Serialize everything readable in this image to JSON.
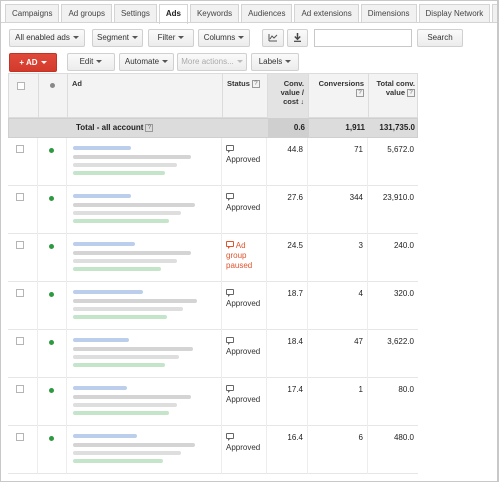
{
  "tabs": [
    {
      "label": "Campaigns",
      "active": false
    },
    {
      "label": "Ad groups",
      "active": false
    },
    {
      "label": "Settings",
      "active": false
    },
    {
      "label": "Ads",
      "active": true
    },
    {
      "label": "Keywords",
      "active": false
    },
    {
      "label": "Audiences",
      "active": false
    },
    {
      "label": "Ad extensions",
      "active": false
    },
    {
      "label": "Dimensions",
      "active": false
    },
    {
      "label": "Display Network",
      "active": false
    }
  ],
  "toolbar": {
    "filter_select": "All enabled ads",
    "segment": "Segment",
    "filter": "Filter",
    "columns": "Columns",
    "search_placeholder": "",
    "search_button": "Search",
    "add_ad": "+ AD",
    "edit": "Edit",
    "automate": "Automate",
    "more_actions": "More actions...",
    "labels": "Labels"
  },
  "table": {
    "headers": {
      "ad": "Ad",
      "status": "Status",
      "conv_value_cost": "Conv. value / cost",
      "conversions": "Conversions",
      "total_conv_value": "Total conv. value"
    },
    "total": {
      "label": "Total - all account",
      "conv_value_cost": "0.6",
      "conversions": "1,911",
      "total_conv_value": "131,735.0"
    },
    "rows": [
      {
        "status": "Approved",
        "paused": false,
        "conv_value_cost": "44.8",
        "conversions": "71",
        "total_conv_value": "5,672.0"
      },
      {
        "status": "Approved",
        "paused": false,
        "conv_value_cost": "27.6",
        "conversions": "344",
        "total_conv_value": "23,910.0"
      },
      {
        "status": "Ad group paused",
        "paused": true,
        "conv_value_cost": "24.5",
        "conversions": "3",
        "total_conv_value": "240.0"
      },
      {
        "status": "Approved",
        "paused": false,
        "conv_value_cost": "18.7",
        "conversions": "4",
        "total_conv_value": "320.0"
      },
      {
        "status": "Approved",
        "paused": false,
        "conv_value_cost": "18.4",
        "conversions": "47",
        "total_conv_value": "3,622.0"
      },
      {
        "status": "Approved",
        "paused": false,
        "conv_value_cost": "17.4",
        "conversions": "1",
        "total_conv_value": "80.0"
      },
      {
        "status": "Approved",
        "paused": false,
        "conv_value_cost": "16.4",
        "conversions": "6",
        "total_conv_value": "480.0"
      }
    ]
  },
  "colors": {
    "enabled_dot": "#2e9a3f",
    "paused_status": "#e0542e",
    "add_button": "#d33a2b"
  }
}
